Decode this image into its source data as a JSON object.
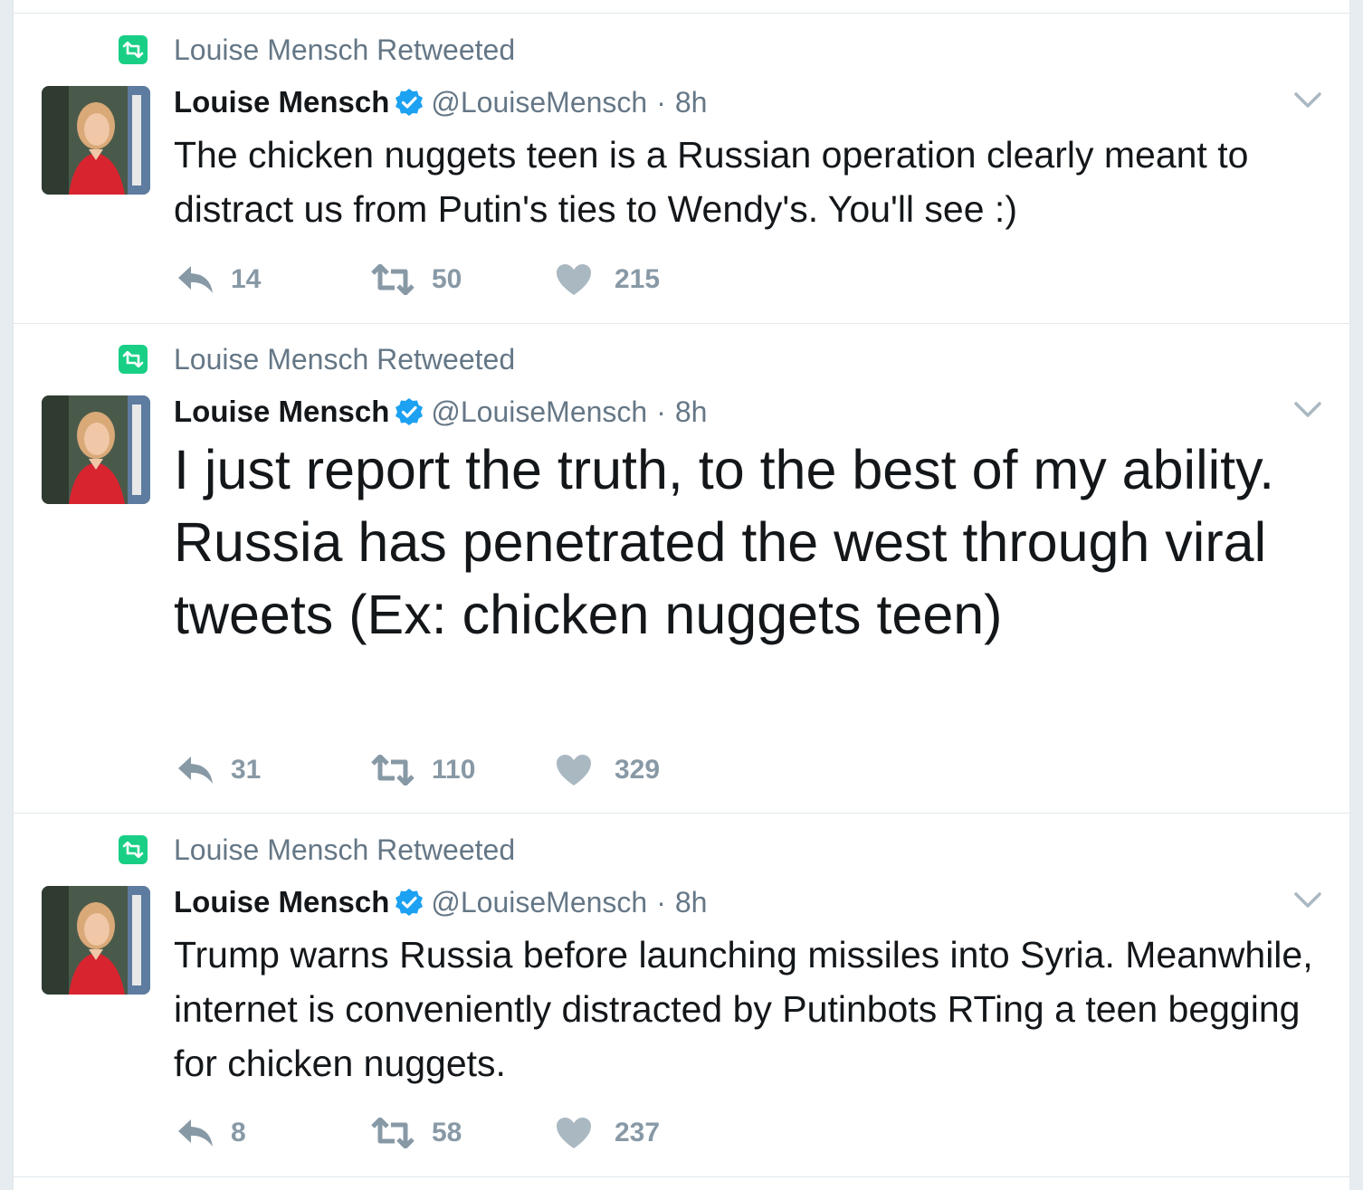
{
  "tweets": [
    {
      "retweeted_by": "Louise Mensch Retweeted",
      "name": "Louise Mensch",
      "handle": "@LouiseMensch",
      "separator": "·",
      "time": "8h",
      "text": "The chicken nuggets teen is a Russian operation clearly meant to distract us from Putin's ties to Wendy's. You'll see :)",
      "replies": "14",
      "retweets": "50",
      "likes": "215"
    },
    {
      "retweeted_by": "Louise Mensch Retweeted",
      "name": "Louise Mensch",
      "handle": "@LouiseMensch",
      "separator": "·",
      "time": "8h",
      "text": "I just report the truth, to the best of my ability. Russia has penetrated the west through viral tweets (Ex: chicken nuggets teen)",
      "replies": "31",
      "retweets": "110",
      "likes": "329"
    },
    {
      "retweeted_by": "Louise Mensch Retweeted",
      "name": "Louise Mensch",
      "handle": "@LouiseMensch",
      "separator": "·",
      "time": "8h",
      "text": "Trump warns Russia before launching missiles into Syria. Meanwhile, internet is conveniently distracted by Putinbots RTing a teen begging for chicken nuggets.",
      "replies": "8",
      "retweets": "58",
      "likes": "237"
    }
  ],
  "icons": {
    "retweet_badge": "retweet-icon",
    "verified": "verified-badge-icon",
    "caret": "chevron-down-icon",
    "reply": "reply-icon",
    "retweet": "retweet-icon",
    "like": "heart-icon"
  },
  "colors": {
    "retweet_green": "#19cf86",
    "verified_blue": "#1da1f2",
    "muted": "#657786",
    "action_gray": "#8899a6",
    "text": "#14171a"
  }
}
